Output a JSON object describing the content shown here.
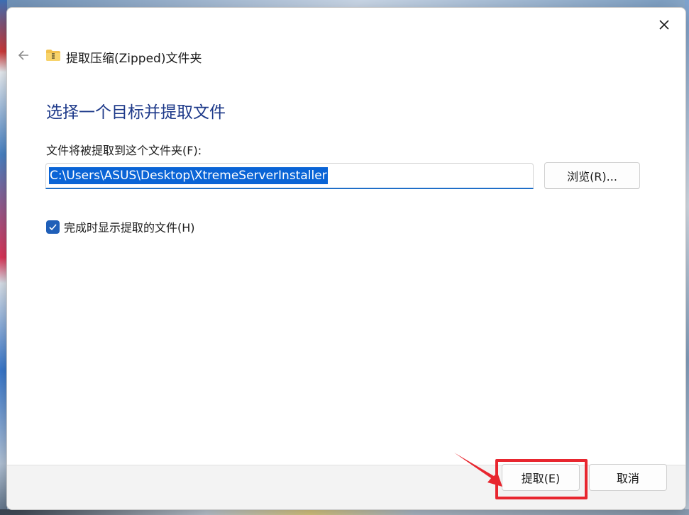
{
  "window": {
    "title": "提取压缩(Zipped)文件夹",
    "close_icon": "close-icon",
    "back_icon": "back-arrow-icon",
    "title_icon": "zip-folder-icon"
  },
  "main": {
    "heading": "选择一个目标并提取文件",
    "field_label": "文件将被提取到这个文件夹(F):",
    "path_value": "C:\\Users\\ASUS\\Desktop\\XtremeServerInstaller",
    "browse_label": "浏览(R)...",
    "show_files_label": "完成时显示提取的文件(H)",
    "show_files_checked": true
  },
  "footer": {
    "extract_label": "提取(E)",
    "cancel_label": "取消"
  },
  "annotation": {
    "color": "#e8262f"
  },
  "colors": {
    "heading": "#1e3a8a",
    "accent": "#0a64d6",
    "checkbox": "#1f5fb8"
  }
}
